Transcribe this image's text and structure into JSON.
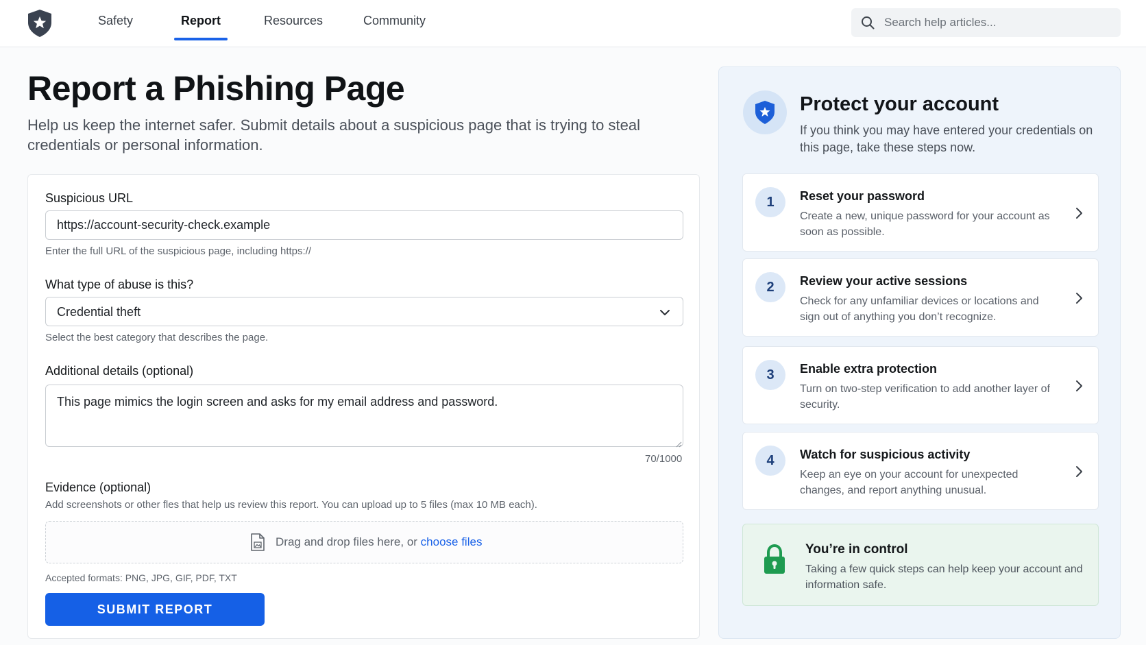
{
  "nav": {
    "items": [
      {
        "label": "Safety"
      },
      {
        "label": "Report"
      },
      {
        "label": "Resources"
      },
      {
        "label": "Community"
      }
    ],
    "active": "Report",
    "search_placeholder": "Search help articles..."
  },
  "page": {
    "title": "Report a Phishing Page",
    "subtitle": "Help us keep the internet safer. Submit details about a suspicious page that is trying to steal credentials or personal information."
  },
  "form": {
    "url": {
      "label": "Suspicious URL",
      "value": "https://account-security-check.example",
      "help": "Enter the full URL of the suspicious page, including https://"
    },
    "abuse_type": {
      "label": "What type of abuse is this?",
      "value": "Credential theft",
      "help": "Select the best category that describes the page."
    },
    "details": {
      "label": "Additional details (optional)",
      "value": "This page mimics the login screen and asks for my email address and password.",
      "counter": "70/1000"
    },
    "evidence": {
      "label": "Evidence (optional)",
      "help": "Add screenshots or other fles that help us review this report. You can upload up to 5 files (max 10 MB each).",
      "drop_text": "Drag and drop files here, or ",
      "choose_link": "choose files",
      "formats": "Accepted formats: PNG, JPG, GIF, PDF, TXT"
    },
    "submit_label": "SUBMIT REPORT"
  },
  "panel": {
    "title": "Protect your account",
    "subtitle": "If you think you may have entered your credentials on this page, take these steps now.",
    "steps": [
      {
        "num": "1",
        "title": "Reset your password",
        "desc": "Create a new, unique password for your account as soon as possible."
      },
      {
        "num": "2",
        "title": "Review your active sessions",
        "desc": "Check for any unfamiliar devices or locations and sign out of anything you don’t recognize."
      },
      {
        "num": "3",
        "title": "Enable extra protection",
        "desc": "Turn on two-step verification to add another layer of security."
      },
      {
        "num": "4",
        "title": "Watch for suspicious activity",
        "desc": "Keep an eye on your account for unexpected changes, and report anything unusual."
      }
    ],
    "control": {
      "title": "You’re in control",
      "desc": "Taking a few quick steps can help keep your account and information safe."
    }
  },
  "colors": {
    "accent": "#1560e6",
    "panel_bg": "#eef4fb",
    "success_bg": "#eaf5ee",
    "lock_green": "#1e9b50"
  },
  "icons": [
    "shield-star-icon",
    "search-icon",
    "chevron-down-icon",
    "file-icon",
    "chevron-right-icon",
    "lock-icon"
  ]
}
